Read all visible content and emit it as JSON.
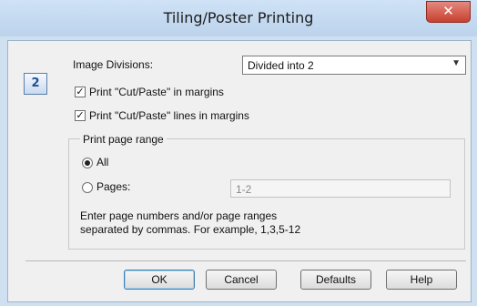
{
  "window": {
    "title": "Tiling/Poster Printing",
    "close_glyph": "✕"
  },
  "preview": {
    "label": "2"
  },
  "image_divisions": {
    "label": "Image Divisions:",
    "selected": "Divided into 2"
  },
  "options": {
    "cut_paste_margins": {
      "label": "Print \"Cut/Paste\" in margins",
      "checked": true
    },
    "cut_paste_lines": {
      "label": "Print \"Cut/Paste\" lines in margins",
      "checked": true
    }
  },
  "page_range": {
    "group_label": "Print page range",
    "all_label": "All",
    "pages_label": "Pages:",
    "pages_value": "1-2",
    "selected": "all",
    "help_line1": "Enter page numbers and/or page ranges",
    "help_line2": "separated by commas. For example, 1,3,5-12"
  },
  "buttons": {
    "ok": "OK",
    "cancel": "Cancel",
    "defaults": "Defaults",
    "help": "Help"
  }
}
